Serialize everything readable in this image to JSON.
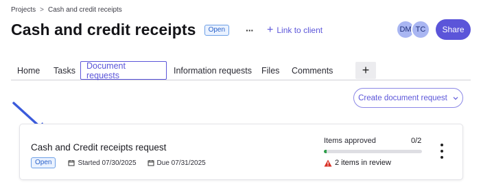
{
  "breadcrumb": {
    "root": "Projects",
    "separator": ">",
    "current": "Cash and credit receipts"
  },
  "header": {
    "title": "Cash and credit receipts",
    "status": "Open",
    "more_label": "···",
    "link_client_label": "Link to client",
    "avatars": [
      "DM",
      "TC"
    ],
    "share_label": "Share"
  },
  "tabs": [
    {
      "label": "Home",
      "active": false
    },
    {
      "label": "Tasks",
      "active": false
    },
    {
      "label": "Document requests",
      "active": true
    },
    {
      "label": "Information requests",
      "active": false
    },
    {
      "label": "Files",
      "active": false
    },
    {
      "label": "Comments",
      "active": false
    }
  ],
  "tab_add_label": "+",
  "create_request_label": "Create document request",
  "request_card": {
    "title": "Cash and Credit receipts request",
    "status": "Open",
    "started": "Started 07/30/2025",
    "due": "Due 07/31/2025",
    "approved_label": "Items approved",
    "approved_count": "0/2",
    "approved_fraction": 0.03,
    "review_text": "2 items in review"
  },
  "colors": {
    "accent": "#5b55d9",
    "status_open_bg": "#eaf2ff",
    "status_open_text": "#2a62c9",
    "warning": "#d93025",
    "progress_fill": "#2e9e4a",
    "arrow": "#3b5bdb"
  },
  "icons": {
    "calendar": "calendar-icon",
    "warning": "warning-icon",
    "chevron": "chevron-down-icon",
    "kebab": "kebab-menu-icon",
    "plus": "plus-icon"
  }
}
